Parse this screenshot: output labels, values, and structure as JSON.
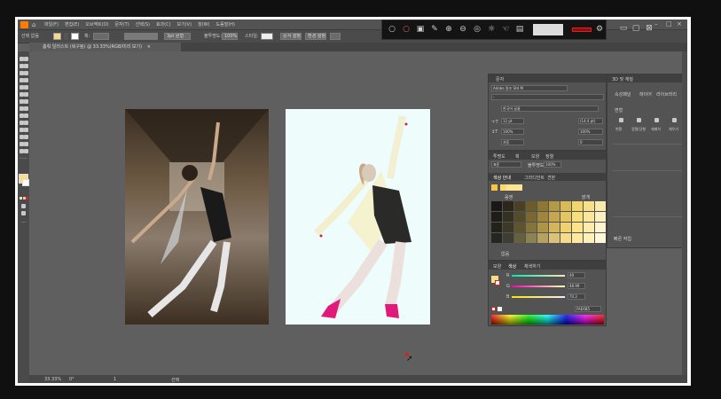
{
  "menu": {
    "items": [
      "파일(F)",
      "편집(E)",
      "오브젝트(O)",
      "문자(T)",
      "선택(S)",
      "효과(C)",
      "보기(V)",
      "창(W)",
      "도움말(H)"
    ]
  },
  "control_bar": {
    "selection_label": "선택 없음",
    "stroke_label": "획:",
    "stroke_value": "3pt 원형",
    "opacity_label": "불투명도:",
    "opacity_value": "100%",
    "style_label": "스타일:",
    "document_setup": "문서 설정",
    "preferences": "환경 설정"
  },
  "document_tab": {
    "title": "춤춰 일러스트 (복구됨) @ 33.33%(RGB/미리 보기)",
    "close": "×"
  },
  "recorder": {
    "colors": {
      "icon": "#cfcfcf",
      "stop": "#e02020"
    }
  },
  "character_panel": {
    "title": "문자",
    "font_family": "Adobe 명조 Std M",
    "font_style": "-",
    "font_size": "12 pt",
    "leading": "(14.4 pt)",
    "tracking": "자동",
    "horizontal_scale": "100%",
    "vertical_scale": "100%",
    "kerning": "0",
    "language": "한국어 글꼴"
  },
  "swatches_panel": {
    "tabs": [
      "투명도",
      "획",
      "모양",
      "정렬"
    ],
    "group_tab": "색상 안내",
    "other_tabs": [
      "그라디언트",
      "견본"
    ],
    "blend_label": "표준",
    "opacity_label": "불투명도:",
    "opacity_value": "100%",
    "col_labels": [
      "음영",
      "",
      "",
      "밝게"
    ],
    "footer": "없음",
    "colors": {
      "swatch_rows": [
        [
          "#191816",
          "#2b271b",
          "#4a4124",
          "#6c5c2c",
          "#8c7735",
          "#b49a45",
          "#d9ba58",
          "#f2d66b",
          "#f6e08a",
          "#f8e9ad"
        ],
        [
          "#1f1d18",
          "#353120",
          "#554a29",
          "#7a6833",
          "#9e863d",
          "#c4a74e",
          "#e4c565",
          "#f9df7a",
          "#fbe79b",
          "#fcf0c1"
        ],
        [
          "#232219",
          "#3b3825",
          "#5e5430",
          "#85743b",
          "#ad9447",
          "#d3b55a",
          "#efd171",
          "#fde587",
          "#fdecaa",
          "#fef5cf"
        ],
        [
          "#252621",
          "#3e3d31",
          "#65603f",
          "#8d8251",
          "#b5a263",
          "#dbc277",
          "#f5dc8c",
          "#feea9f",
          "#fff0ba",
          "#fff7d8"
        ]
      ],
      "base": [
        "#f6c443",
        "#ffd96a",
        "#ffe58f"
      ]
    }
  },
  "color_panel": {
    "tabs": [
      "모양",
      "색상",
      "채색하기"
    ],
    "r_label": "R",
    "r_value": "49",
    "g_label": "G",
    "g_value": "48.99",
    "b_label": "B",
    "b_value": "70.2",
    "hex_value": "FAE6B5"
  },
  "properties_panel": {
    "title": "3D 및 재질",
    "tabs": [
      "속성패널",
      "레이어",
      "라이브러리"
    ],
    "section_transform": "변형",
    "section_rows": [
      "변환",
      "정렬/균형",
      "재배치",
      "채우기"
    ],
    "quick_actions": "빠른 작업",
    "doc_setup": "문서 설정",
    "prefs": "환경 설정"
  },
  "statusbar": {
    "zoom": "33.33%",
    "angle": "0°",
    "page": "1",
    "tool": "선택"
  }
}
